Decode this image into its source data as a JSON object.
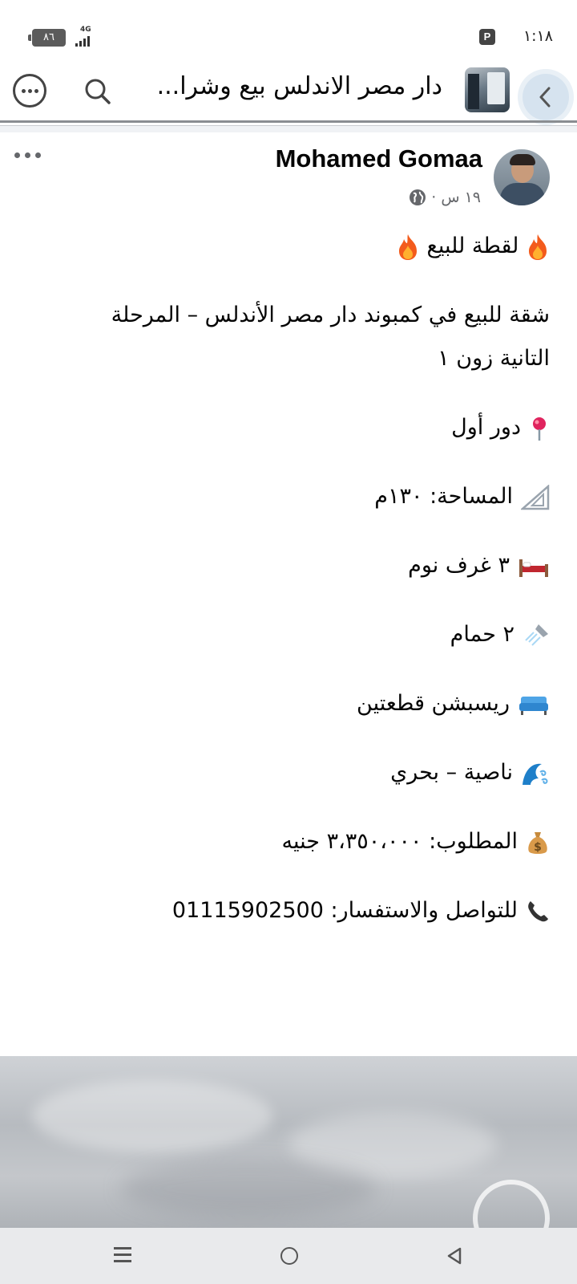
{
  "status_bar": {
    "time": "١:١٨",
    "battery": "٨٦",
    "network": "4G"
  },
  "header": {
    "group_title": "دار مصر الاندلس بيع وشرا...",
    "icons": [
      "back-arrow-icon",
      "search-icon",
      "more-options-icon"
    ]
  },
  "post": {
    "author": "Mohamed Gomaa",
    "time": "١٩ س",
    "separator": "·",
    "privacy_icon": "globe-icon",
    "lines": {
      "headline": "لقطة للبيع",
      "description": "شقة للبيع في كمبوند دار مصر الأندلس – المرحلة التانية زون ١",
      "floor": "دور أول",
      "area": "المساحة: ١٣٠م",
      "bedrooms": "٣ غرف نوم",
      "bathrooms": "٢ حمام",
      "reception": "ريسبشن قطعتين",
      "orientation": "ناصية – بحري",
      "price": "المطلوب: ٣،٣٥٠،٠٠٠ جنيه",
      "contact": "للتواصل والاستفسار: 01115902500"
    }
  },
  "colors": {
    "text": "#050505",
    "meta": "#65676b",
    "back_highlight": "#d6e3ef",
    "nav_bar": "#e9eaec"
  }
}
